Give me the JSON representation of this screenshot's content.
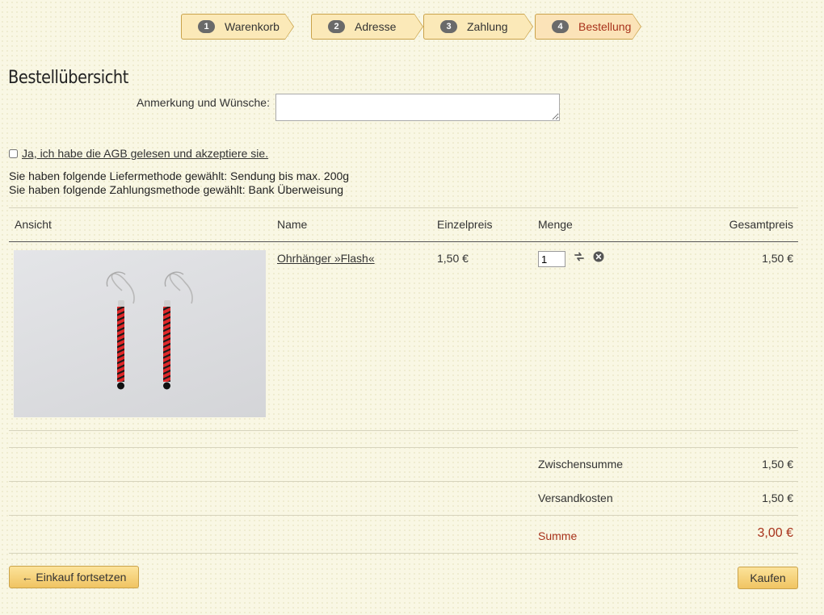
{
  "steps": [
    {
      "num": "1",
      "label": "Warenkorb"
    },
    {
      "num": "2",
      "label": "Adresse"
    },
    {
      "num": "3",
      "label": "Zahlung"
    },
    {
      "num": "4",
      "label": "Bestellung"
    }
  ],
  "page": {
    "title": "Bestellübersicht",
    "remark_label": "Anmerkung und Wünsche:",
    "remark_value": "",
    "agb_text": "Ja, ich habe die AGB gelesen und akzeptiere sie.",
    "agb_checked": false,
    "delivery_line": "Sie haben folgende Liefermethode gewählt: Sendung bis max. 200g",
    "payment_line": "Sie haben folgende Zahlungsmethode gewählt: Bank Überweisung"
  },
  "table": {
    "headers": {
      "view": "Ansicht",
      "name": "Name",
      "unit_price": "Einzelpreis",
      "quantity": "Menge",
      "total": "Gesamtpreis"
    },
    "items": [
      {
        "image_icon": "product-photo-earrings",
        "name": "Ohrhänger »Flash«",
        "unit_price": "1,50 €",
        "quantity": "1",
        "total": "1,50 €"
      }
    ]
  },
  "totals": {
    "subtotal_label": "Zwischensumme",
    "subtotal_value": "1,50 €",
    "shipping_label": "Versandkosten",
    "shipping_value": "1,50 €",
    "sum_label": "Summe",
    "sum_value": "3,00 €"
  },
  "buttons": {
    "continue_label": "← Einkauf fortsetzen",
    "buy_label": "Kaufen"
  },
  "colors": {
    "accent_red": "#a8321b",
    "button_gold": "#f0c462",
    "background": "#f9f7e4"
  }
}
